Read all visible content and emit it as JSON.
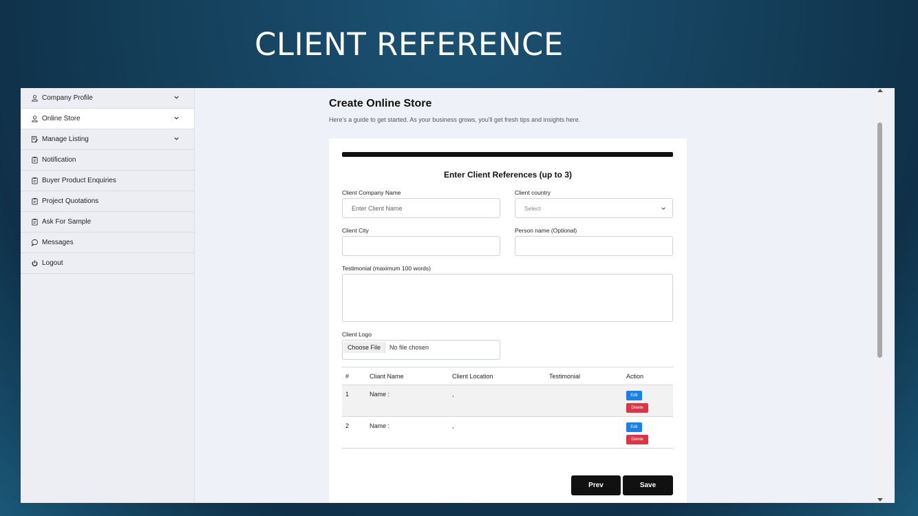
{
  "slide_title": "CLIENT REFERENCE",
  "sidebar": {
    "items": [
      {
        "label": "Company Profile",
        "icon": "user-icon",
        "has_chevron": true
      },
      {
        "label": "Online Store",
        "icon": "user-icon",
        "has_chevron": true,
        "active": true
      },
      {
        "label": "Manage Listing",
        "icon": "edit-list-icon",
        "has_chevron": true
      },
      {
        "label": "Notification",
        "icon": "clipboard-icon"
      },
      {
        "label": "Buyer Product Enquiries",
        "icon": "clipboard-icon"
      },
      {
        "label": "Project Quotations",
        "icon": "clipboard-icon"
      },
      {
        "label": "Ask For Sample",
        "icon": "clipboard-icon"
      },
      {
        "label": "Messages",
        "icon": "chat-icon"
      },
      {
        "label": "Logout",
        "icon": "power-icon"
      }
    ]
  },
  "main": {
    "title": "Create Online Store",
    "subtitle": "Here's a guide to get started. As your business grows, you'll get fresh tips and insights here."
  },
  "form": {
    "heading": "Enter Client References (up to 3)",
    "company_name_label": "Client Company Name",
    "company_name_placeholder": "Enter Client Name",
    "country_label": "Client country",
    "country_value": "Select",
    "city_label": "Client City",
    "person_label": "Person name (Optional)",
    "testimonial_label": "Testimonial (maximum 100 words)",
    "logo_label": "Client Logo",
    "file_button": "Choose File",
    "file_status": "No file chosen"
  },
  "table": {
    "headers": [
      "#",
      "Cliant Name",
      "Client Location",
      "Testimonial",
      "Action"
    ],
    "rows": [
      {
        "num": "1",
        "name": "Name :",
        "location": ",",
        "testimonial": "",
        "edit": "Edit",
        "delete": "Delete"
      },
      {
        "num": "2",
        "name": "Name :",
        "location": ",",
        "testimonial": "",
        "edit": "Edit",
        "delete": "Delete"
      }
    ]
  },
  "actions": {
    "prev_label": "Prev",
    "save_label": "Save"
  },
  "colors": {
    "edit_button": "#1a7fe6",
    "delete_button": "#dc3545",
    "primary_dark": "#111111"
  }
}
